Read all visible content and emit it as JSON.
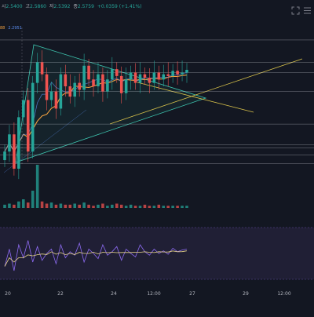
{
  "header": {
    "open_label": "시",
    "open": "2.5400",
    "high_label": "고",
    "high": "2.5860",
    "low_label": "저",
    "low": "2.5392",
    "close_label": "종",
    "close": "2.5759",
    "change": "+0.0359 (+1.41%)"
  },
  "ma_legend": {
    "ma1": "88",
    "ma2": "2.2951"
  },
  "toolbar": {
    "expand_icon": "expand-icon",
    "menu_icon": "menu-icon"
  },
  "colors": {
    "background": "#131722",
    "up": "#26a69a",
    "down": "#ef5350",
    "ma_orange": "#f0a040",
    "ma_blue": "#5b8def",
    "trendline": "#3ec6b0",
    "projection": "#d8c24a",
    "rsi_line": "#8c6af0",
    "rsi_band": "#3a2f5a"
  },
  "chart_data": {
    "type": "candlestick",
    "x_tick_labels": [
      "20",
      "22",
      "24",
      "12:00",
      "27",
      "29",
      "12:00"
    ],
    "price_series": [
      2.1,
      2.2,
      2.0,
      2.3,
      2.4,
      2.1,
      2.5,
      2.62,
      2.55,
      2.4,
      2.45,
      2.35,
      2.55,
      2.48,
      2.42,
      2.5,
      2.46,
      2.6,
      2.52,
      2.48,
      2.55,
      2.45,
      2.52,
      2.58,
      2.54,
      2.44,
      2.52,
      2.56,
      2.5,
      2.55,
      2.53,
      2.5,
      2.56,
      2.52,
      2.55,
      2.54,
      2.57,
      2.55,
      2.56,
      2.5759
    ],
    "volume_series": [
      3,
      4,
      3,
      6,
      8,
      5,
      16,
      40,
      6,
      4,
      5,
      3,
      4,
      3,
      3,
      4,
      3,
      5,
      3,
      2,
      3,
      4,
      2,
      3,
      4,
      3,
      2,
      3,
      2,
      2,
      3,
      2,
      2,
      3,
      2,
      2,
      2,
      2,
      2,
      2
    ],
    "rsi_series": [
      35,
      55,
      30,
      60,
      45,
      65,
      40,
      58,
      42,
      50,
      55,
      38,
      60,
      45,
      52,
      48,
      62,
      40,
      55,
      50,
      44,
      60,
      48,
      52,
      58,
      42,
      55,
      50,
      46,
      60,
      52,
      48,
      55,
      50,
      53,
      49,
      56,
      52,
      54,
      55
    ],
    "horizontal_levels": [
      2.75,
      2.62,
      2.56,
      2.45,
      2.26,
      2.14,
      2.12,
      2.08,
      2.03
    ],
    "grid": false
  }
}
